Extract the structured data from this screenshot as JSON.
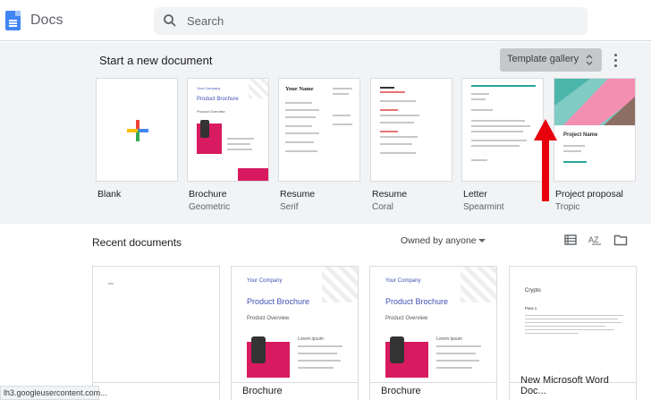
{
  "header": {
    "app_title": "Docs",
    "search_placeholder": "Search"
  },
  "templates": {
    "section_title": "Start a new document",
    "gallery_label": "Template gallery",
    "items": [
      {
        "name": "Blank",
        "sub": ""
      },
      {
        "name": "Brochure",
        "sub": "Geometric"
      },
      {
        "name": "Resume",
        "sub": "Serif"
      },
      {
        "name": "Resume",
        "sub": "Coral"
      },
      {
        "name": "Letter",
        "sub": "Spearmint"
      },
      {
        "name": "Project proposal",
        "sub": "Tropic"
      }
    ],
    "thumb_text": {
      "company": "Your Company",
      "brochure": "Product Brochure",
      "overview": "Product Overview",
      "your_name": "Your Name",
      "project_name": "Project Name"
    }
  },
  "recent": {
    "section_title": "Recent documents",
    "owner_filter": "Owned by anyone",
    "docs": [
      {
        "name": ""
      },
      {
        "name": "Brochure"
      },
      {
        "name": "Brochure"
      },
      {
        "name": "New Microsoft Word Doc..."
      }
    ],
    "crypto_heading": "Crypto",
    "crypto_para": "Para 1",
    "lorem": "Lorem ipsum"
  },
  "status_bar": "lh3.googleusercontent.com...",
  "colors": {
    "accent_blue": "#4285f4",
    "pink": "#d81b60",
    "arrow": "#e8000d",
    "gray_bg": "#f1f3f4"
  }
}
